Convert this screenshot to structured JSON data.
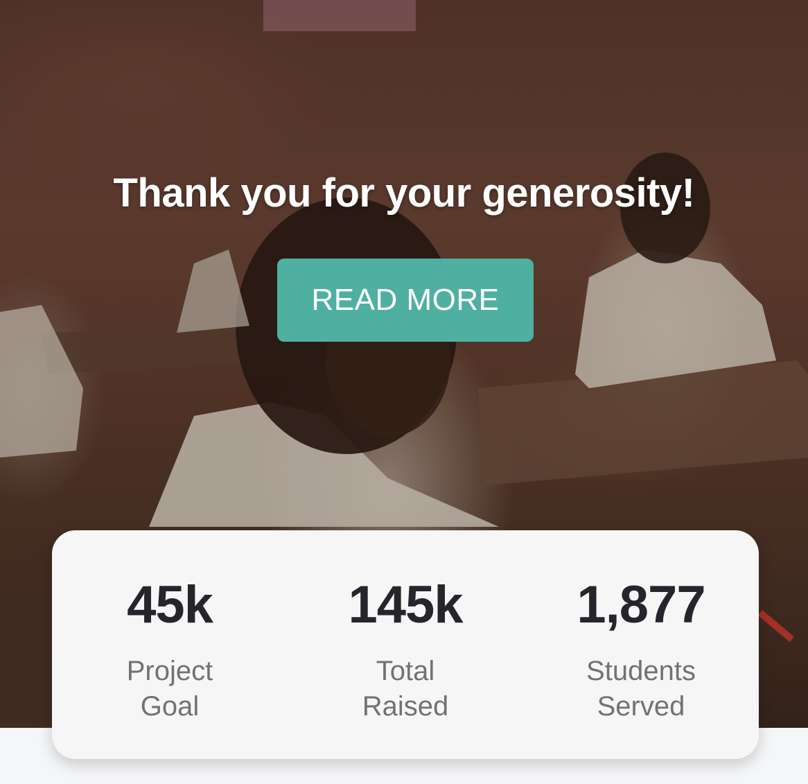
{
  "hero": {
    "headline": "Thank you for your generosity!",
    "button_label": "READ MORE",
    "button_color": "#4fb0a2",
    "image_alt": "classroom-photo"
  },
  "stats": [
    {
      "value": "45k",
      "label": "Project Goal"
    },
    {
      "value": "145k",
      "label": "Total Raised"
    },
    {
      "value": "1,877",
      "label": "Students Served"
    }
  ]
}
